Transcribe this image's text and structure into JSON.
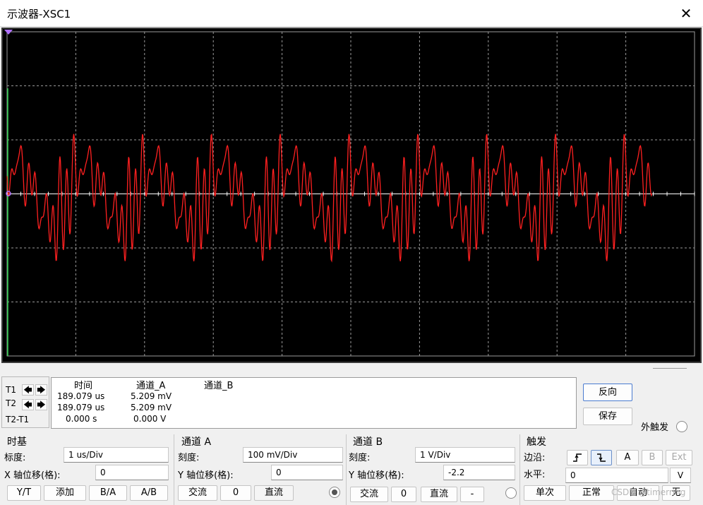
{
  "window": {
    "title": "示波器-XSC1",
    "close_icon": "close-icon"
  },
  "scope": {
    "background": "#000000",
    "grid_color": "#9a9a9a",
    "trace_color": "#ff2020",
    "marker_color": "#b070ff"
  },
  "chart_data": {
    "type": "line",
    "divisions_x": 10,
    "divisions_y": 6,
    "time_per_div_us": 1,
    "volts_per_div_mV": 100,
    "series": [
      {
        "channel": "A",
        "color": "#ff2020"
      }
    ]
  },
  "readout": {
    "col_time": "时间",
    "col_a": "通道_A",
    "col_b": "通道_B",
    "t1_label": "T1",
    "t2_label": "T2",
    "t2t1_label": "T2-T1",
    "rows": [
      {
        "time": "189.079 us",
        "a": "5.209 mV"
      },
      {
        "time": "189.079 us",
        "a": "5.209 mV"
      },
      {
        "time": "0.000 s",
        "a": "0.000 V"
      }
    ],
    "reverse_button": "反向",
    "save_button": "保存",
    "ext_trigger_label": "外触发"
  },
  "timebase": {
    "title": "时基",
    "scale_label": "标度:",
    "scale_value": "1 us/Div",
    "xpos_label": "X 轴位移(格):",
    "xpos_value": "0",
    "buttons": [
      "Y/T",
      "添加",
      "B/A",
      "A/B"
    ]
  },
  "channel_a": {
    "title": "通道 A",
    "scale_label": "刻度:",
    "scale_value": "100 mV/Div",
    "ypos_label": "Y 轴位移(格):",
    "ypos_value": "0",
    "ac": "交流",
    "zero": "0",
    "dc": "直流"
  },
  "channel_b": {
    "title": "通道 B",
    "scale_label": "刻度:",
    "scale_value": "1  V/Div",
    "ypos_label": "Y 轴位移(格):",
    "ypos_value": "-2.2",
    "ac": "交流",
    "zero": "0",
    "dc": "直流",
    "minus": "-"
  },
  "trigger": {
    "title": "触发",
    "edge_label": "边沿:",
    "rise_icon": "rising-edge-icon",
    "fall_icon": "falling-edge-icon",
    "a": "A",
    "b": "B",
    "ext": "Ext",
    "level_label": "水平:",
    "level_value": "0",
    "level_unit": "V",
    "single": "单次",
    "normal": "正常",
    "auto": "自动",
    "none": "无"
  },
  "watermark": "CSDN @timerring"
}
